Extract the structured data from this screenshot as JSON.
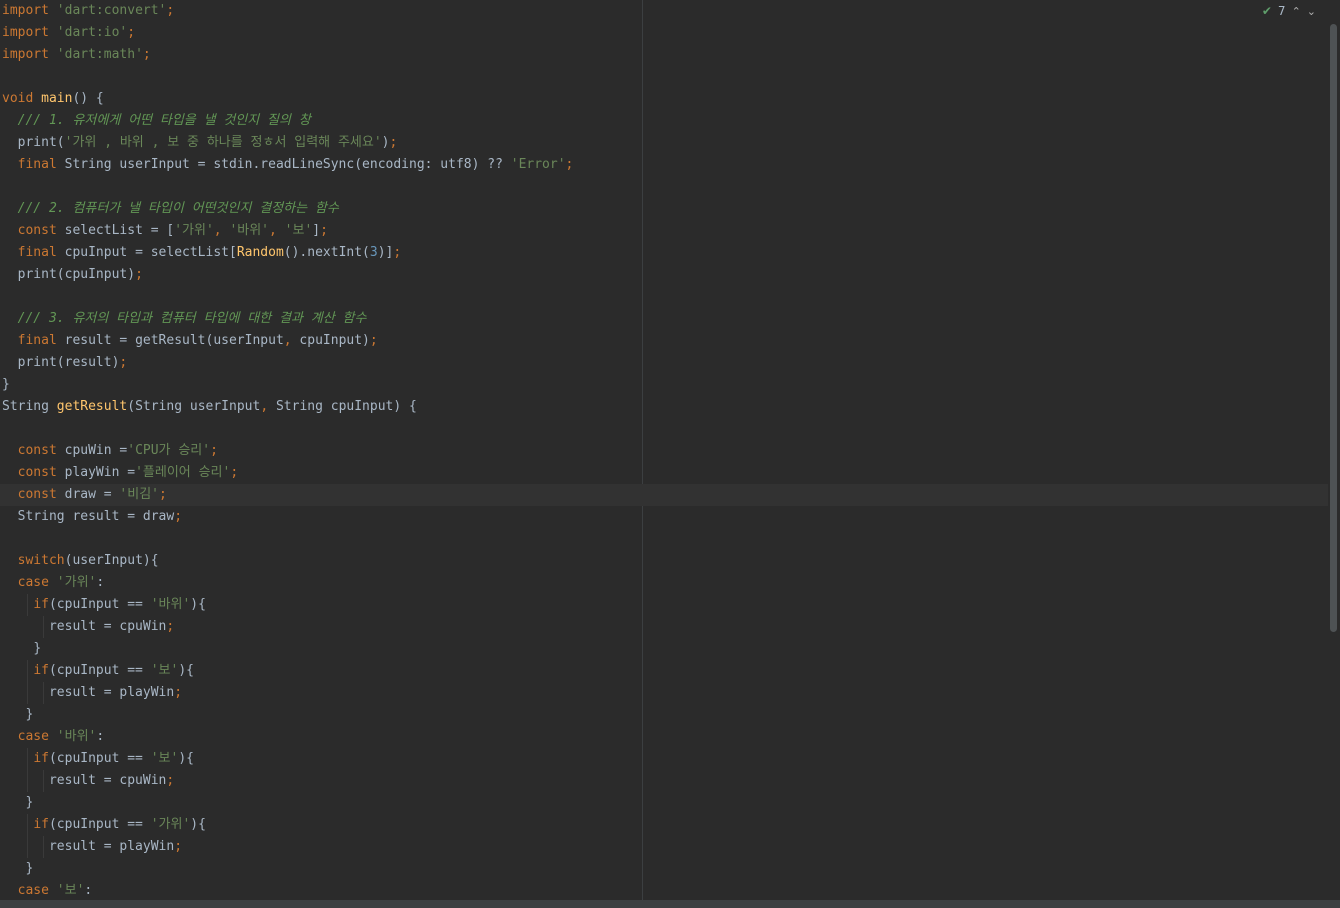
{
  "inspection": {
    "warnings_count": "7",
    "ok_icon": "check-icon",
    "up_icon": "chevron-up-icon",
    "down_icon": "chevron-down-icon"
  },
  "code": {
    "l1": [
      "import",
      " ",
      "'dart:convert'",
      ";"
    ],
    "l2": [
      "import",
      " ",
      "'dart:io'",
      ";"
    ],
    "l3": [
      "import",
      " ",
      "'dart:math'",
      ";"
    ],
    "l5": [
      "void",
      " ",
      "main",
      "() {"
    ],
    "l6": "/// 1. 유저에게 어떤 타입을 낼 것인지 질의 창",
    "l7": [
      "print(",
      "'가위 , 바위 , 보 중 하나를 정ㅎ서 입력해 주세요'",
      ")",
      ";"
    ],
    "l8": [
      "final",
      " String userInput = stdin.readLineSync(encoding: utf8) ?? ",
      "'Error'",
      ";"
    ],
    "l10": "/// 2. 컴퓨터가 낼 타입이 어떤것인지 결정하는 함수",
    "l11": [
      "const",
      " selectList = [",
      "'가위'",
      ", ",
      "'바위'",
      ", ",
      "'보'",
      "]",
      ";"
    ],
    "l12": [
      "final",
      " cpuInput = selectList[",
      "Random",
      "().nextInt(",
      "3",
      ")]",
      ";"
    ],
    "l13": [
      "print(cpuInput)",
      ";"
    ],
    "l15": "/// 3. 유저의 타입과 컴퓨터 타입에 대한 결과 계산 함수",
    "l16": [
      "final",
      " result = getResult(userInput",
      ",",
      " cpuInput)",
      ";"
    ],
    "l17": [
      "print(result)",
      ";"
    ],
    "l18": "}",
    "l19": [
      "String ",
      "getResult",
      "(String userInput",
      ",",
      " String cpuInput) {"
    ],
    "l21": [
      "const",
      " cpuWin =",
      "'CPU가 승리'",
      ";"
    ],
    "l22": [
      "const",
      " playWin =",
      "'플레이어 승리'",
      ";"
    ],
    "l23": [
      "const",
      " draw = ",
      "'비김'",
      ";"
    ],
    "l24": [
      "String result = draw",
      ";"
    ],
    "l26": [
      "switch",
      "(userInput){"
    ],
    "l27": [
      "case",
      " ",
      "'가위'",
      ":"
    ],
    "l28": [
      "if",
      "(cpuInput == ",
      "'바위'",
      "){"
    ],
    "l29": [
      "result = cpuWin",
      ";"
    ],
    "l30": "}",
    "l31": [
      "if",
      "(cpuInput == ",
      "'보'",
      "){"
    ],
    "l32": [
      "result = playWin",
      ";"
    ],
    "l33": "}",
    "l34": [
      "case",
      " ",
      "'바위'",
      ":"
    ],
    "l35": [
      "if",
      "(cpuInput == ",
      "'보'",
      "){"
    ],
    "l36": [
      "result = cpuWin",
      ";"
    ],
    "l37": "}",
    "l38": [
      "if",
      "(cpuInput == ",
      "'가위'",
      "){"
    ],
    "l39": [
      "result = playWin",
      ";"
    ],
    "l40": "}",
    "l41": [
      "case",
      " ",
      "'보'",
      ":"
    ]
  }
}
